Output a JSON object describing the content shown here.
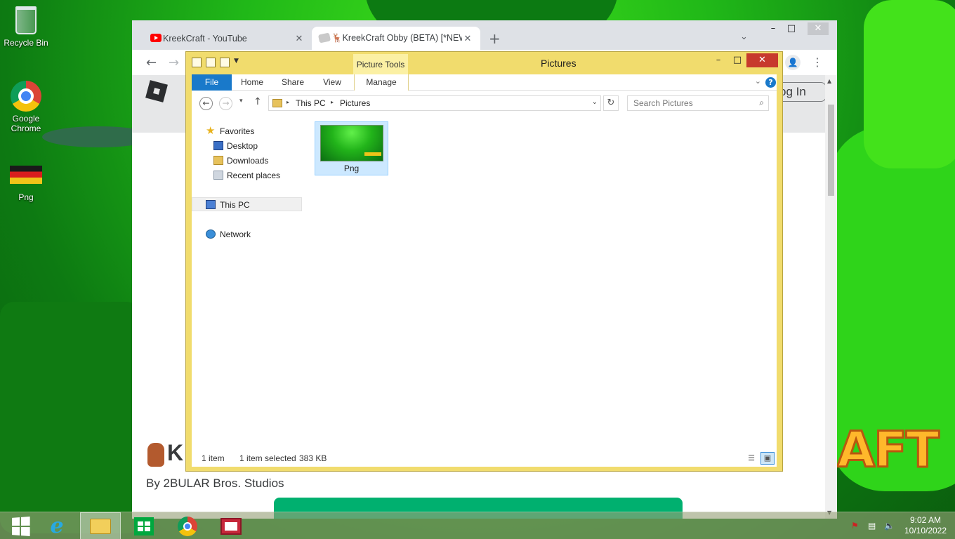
{
  "desktop": {
    "icons": [
      {
        "label": "Recycle Bin",
        "icon": "recycle-bin-icon"
      },
      {
        "label": "Google Chrome",
        "icon": "chrome-icon"
      },
      {
        "label": "Png",
        "icon": "image-file-icon"
      }
    ],
    "wallpaper_text": "AFT"
  },
  "browser": {
    "tabs": [
      {
        "title": "KreekCraft - YouTube",
        "favicon": "youtube-icon",
        "close": "✕"
      },
      {
        "title": "🦌KreekCraft Obby (BETA) [*NEW",
        "favicon": "roblox-icon",
        "close": "✕"
      }
    ],
    "new_tab": "+",
    "tab_search": "⌄",
    "controls": {
      "minimize": "–",
      "maximize": "□",
      "close": "✕"
    },
    "nav": {
      "back": "←",
      "forward": "→",
      "profile": "👤",
      "menu": "⋮"
    },
    "page": {
      "login_label": "og In",
      "game_title": "K",
      "creator": "By 2BULAR Bros. Studios"
    }
  },
  "explorer": {
    "title": "Pictures",
    "contextual_tab_group": "Picture Tools",
    "controls": {
      "minimize": "–",
      "maximize": "□",
      "close": "✕"
    },
    "ribbon_tabs": [
      "File",
      "Home",
      "Share",
      "View",
      "Manage"
    ],
    "ribbon_expand": "⌄",
    "help": "?",
    "address": {
      "back": "←",
      "forward": "→",
      "recent": "▾",
      "up": "↑",
      "segments": [
        "This PC",
        "Pictures"
      ],
      "arrow": "▸",
      "dropdown": "⌄",
      "refresh": "↻"
    },
    "search": {
      "placeholder": "Search Pictures",
      "icon": "search-icon"
    },
    "nav_pane": {
      "favorites_label": "Favorites",
      "favorites": [
        "Desktop",
        "Downloads",
        "Recent places"
      ],
      "this_pc": "This PC",
      "network": "Network"
    },
    "files": [
      {
        "name": "Png",
        "type": "image",
        "selected": true
      }
    ],
    "status": {
      "count": "1 item",
      "selection": "1 item selected",
      "size": "383 KB"
    }
  },
  "taskbar": {
    "apps": [
      {
        "name": "start",
        "icon": "windows-logo-icon"
      },
      {
        "name": "internet-explorer",
        "icon": "ie-icon"
      },
      {
        "name": "file-explorer",
        "icon": "folder-icon",
        "active": true
      },
      {
        "name": "store",
        "icon": "store-icon"
      },
      {
        "name": "chrome",
        "icon": "chrome-icon"
      },
      {
        "name": "news",
        "icon": "news-icon"
      }
    ],
    "clock": {
      "time": "9:02 AM",
      "date": "10/10/2022"
    }
  },
  "colors": {
    "explorer_frame": "#f1dc6d",
    "file_tab": "#1979ca",
    "selection": "#cce8ff",
    "close_red": "#c7392d"
  }
}
